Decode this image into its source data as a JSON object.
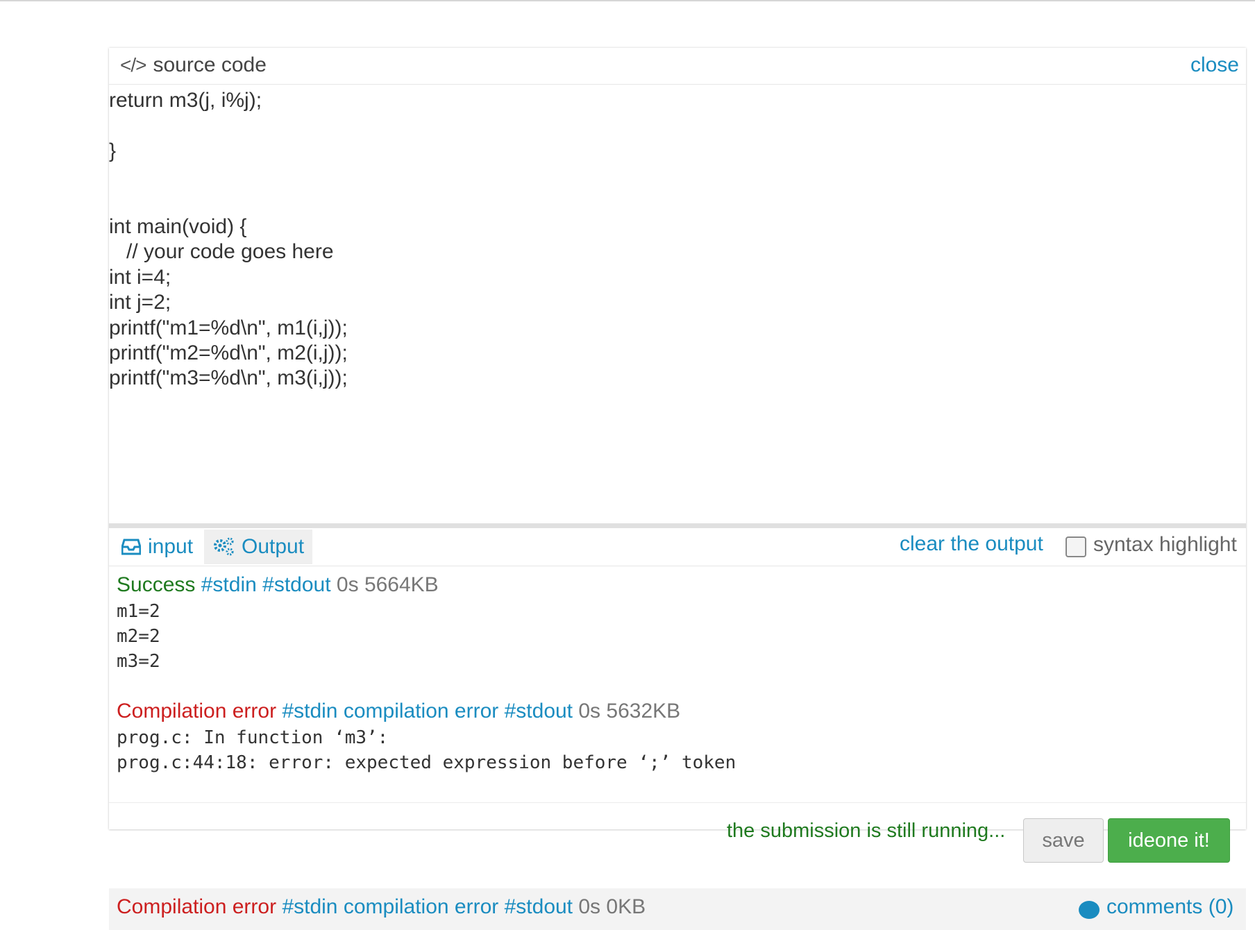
{
  "header": {
    "title": "source code",
    "close_label": "close"
  },
  "code": {
    "lines": [
      "return m3(j, i%j);",
      "}",
      "int main(void) {",
      "   // your code goes here",
      "int i=4;",
      "int j=2;",
      "printf(\"m1=%d\\n\", m1(i,j));",
      "printf(\"m2=%d\\n\", m2(i,j));",
      "printf(\"m3=%d\\n\", m3(i,j));"
    ]
  },
  "io": {
    "input_tab": "input",
    "output_tab": "Output",
    "clear_label": "clear the output",
    "syntax_label": "syntax highlight",
    "syntax_checked": false
  },
  "output": {
    "run1": {
      "status": "Success",
      "stdin": "#stdin",
      "stdout": "#stdout",
      "time": "0s",
      "memory": "5664KB",
      "lines": [
        "m1=2",
        "m2=2",
        "m3=2"
      ]
    },
    "run2": {
      "status": "Compilation error",
      "stdin": "#stdin",
      "ce": "compilation error",
      "stdout": "#stdout",
      "time": "0s",
      "memory": "5632KB",
      "lines": [
        "prog.c: In function ‘m3’:",
        "prog.c:44:18: error: expected expression before ‘;’ token"
      ]
    }
  },
  "footer": {
    "running_text": "the submission is still running...",
    "save_label": "save",
    "submit_label": "ideone it!"
  },
  "next_panel": {
    "status": "Compilation error",
    "stdin": "#stdin",
    "ce": "compilation error",
    "stdout": "#stdout",
    "time": "0s",
    "memory": "0KB",
    "comments_label": "comments (0)"
  },
  "colors": {
    "link": "#1a8cc0",
    "success": "#1f7a1f",
    "error": "#cc1f1f",
    "submit_button": "#4cae4c"
  }
}
